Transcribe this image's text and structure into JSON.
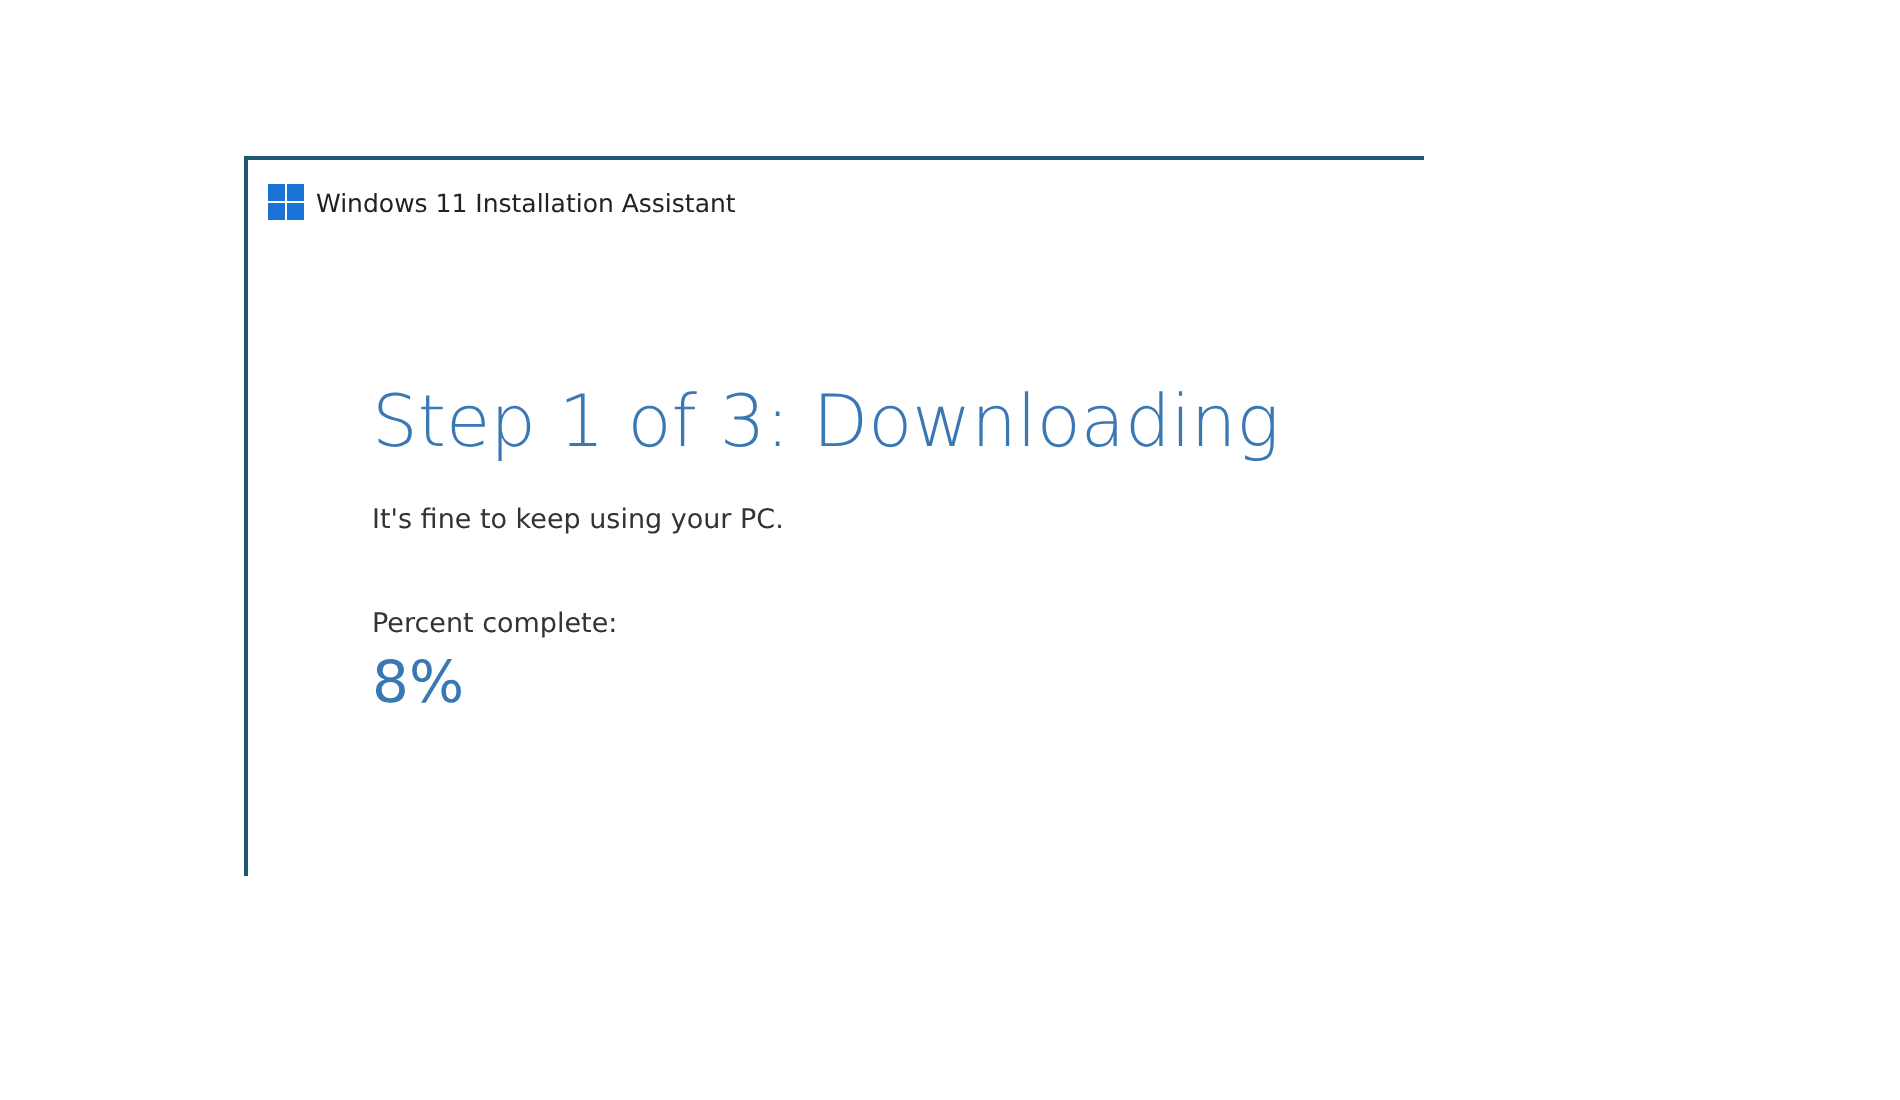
{
  "window": {
    "title": "Windows 11 Installation Assistant"
  },
  "heading": "Step 1 of 3: Downloading",
  "subtitle": "It's fine to keep using your PC.",
  "progress": {
    "label": "Percent complete:",
    "value": "8%"
  }
}
